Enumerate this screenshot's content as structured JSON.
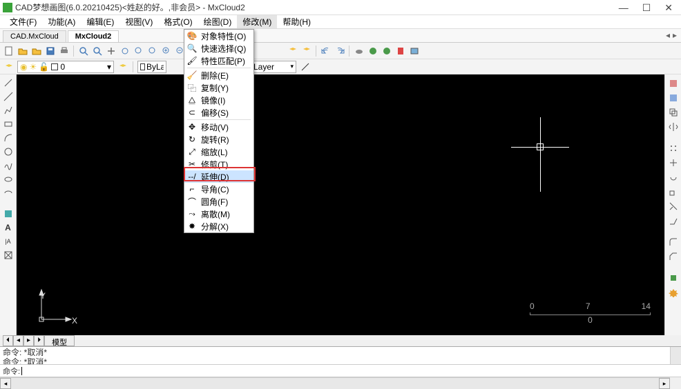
{
  "title": "CAD梦想画图(6.0.20210425)<姓赵的好。,非会员> - MxCloud2",
  "menus": {
    "file": "文件(F)",
    "func": "功能(A)",
    "edit": "编辑(E)",
    "view": "视图(V)",
    "format": "格式(O)",
    "draw": "绘图(D)",
    "modify": "修改(M)",
    "help": "帮助(H)"
  },
  "tabs": {
    "t1": "CAD.MxCloud",
    "t2": "MxCloud2"
  },
  "layer": {
    "current": "0"
  },
  "props": {
    "bylayer1": "ByLaye",
    "bylayer2": "ByLayer"
  },
  "dropdown": {
    "i1": "对象特性(O)",
    "i2": "快速选择(Q)",
    "i3": "特性匹配(P)",
    "i4": "删除(E)",
    "i5": "复制(Y)",
    "i6": "镜像(I)",
    "i7": "偏移(S)",
    "i8": "移动(V)",
    "i9": "旋转(R)",
    "i10": "缩放(L)",
    "i11": "修剪(T)",
    "i12": "延伸(D)",
    "i13": "导角(C)",
    "i14": "圆角(F)",
    "i15": "离散(M)",
    "i16": "分解(X)"
  },
  "ucs": {
    "x": "X",
    "y": "Y"
  },
  "scale": {
    "a": "0",
    "b": "7",
    "c": "14",
    "d": "0"
  },
  "btabs": {
    "model": "模型"
  },
  "cmd": {
    "l1": "命令: *取消*",
    "l2": "命令: *取消*",
    "l3": "命令: *取消*",
    "prompt": "命令:"
  }
}
